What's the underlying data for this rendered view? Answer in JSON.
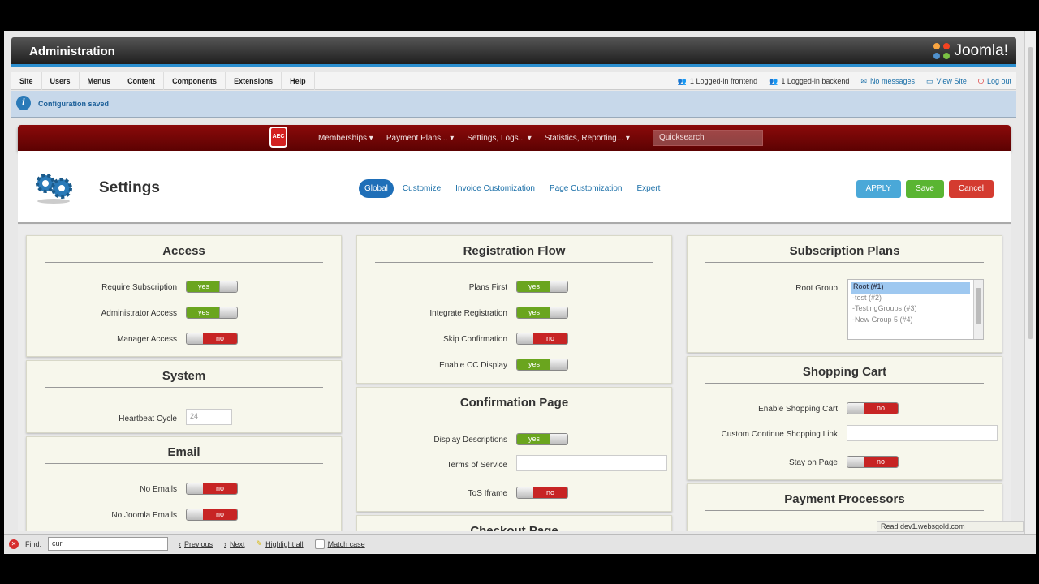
{
  "admin": {
    "title": "Administration",
    "logo": "Joomla!"
  },
  "menu": [
    "Site",
    "Users",
    "Menus",
    "Content",
    "Components",
    "Extensions",
    "Help"
  ],
  "status": {
    "frontend": "1 Logged-in frontend",
    "backend": "1 Logged-in backend",
    "messages": "No messages",
    "view_site": "View Site",
    "logout": "Log out"
  },
  "message": "Configuration saved",
  "aec": {
    "badge": "AEC",
    "nav": [
      "Memberships",
      "Payment Plans...",
      "Settings, Logs...",
      "Statistics, Reporting..."
    ],
    "quicksearch": "Quicksearch"
  },
  "settings": {
    "title": "Settings",
    "tabs": [
      "Global",
      "Customize",
      "Invoice Customization",
      "Page Customization",
      "Expert"
    ],
    "actions": {
      "apply": "APPLY",
      "save": "Save",
      "cancel": "Cancel"
    }
  },
  "toggle": {
    "yes": "yes",
    "no": "no"
  },
  "colors": {
    "header_blue": "#2b8fd0",
    "aec_red": "#8b0a0a",
    "tab_active": "#1f6fb8",
    "yes_green": "#6aa51e",
    "no_red": "#c72424"
  },
  "access": {
    "title": "Access",
    "require_subscription": {
      "label": "Require Subscription",
      "value": "yes"
    },
    "admin_access": {
      "label": "Administrator Access",
      "value": "yes"
    },
    "manager_access": {
      "label": "Manager Access",
      "value": "no"
    }
  },
  "system": {
    "title": "System",
    "heartbeat": {
      "label": "Heartbeat Cycle",
      "placeholder": "24"
    }
  },
  "email": {
    "title": "Email",
    "no_emails": {
      "label": "No Emails",
      "value": "no"
    },
    "no_joomla_emails": {
      "label": "No Joomla Emails",
      "value": "no"
    }
  },
  "registration": {
    "title": "Registration Flow",
    "plans_first": {
      "label": "Plans First",
      "value": "yes"
    },
    "integrate": {
      "label": "Integrate Registration",
      "value": "yes"
    },
    "skip_confirmation": {
      "label": "Skip Confirmation",
      "value": "no"
    },
    "cc_display": {
      "label": "Enable CC Display",
      "value": "yes"
    }
  },
  "confirmation": {
    "title": "Confirmation Page",
    "descriptions": {
      "label": "Display Descriptions",
      "value": "yes"
    },
    "tos": {
      "label": "Terms of Service"
    },
    "tos_iframe": {
      "label": "ToS Iframe",
      "value": "no"
    }
  },
  "checkout": {
    "title": "Checkout Page"
  },
  "plans": {
    "title": "Subscription Plans",
    "root_group": {
      "label": "Root Group",
      "options": [
        "Root (#1)",
        "-test (#2)",
        "-TestingGroups (#3)",
        "-New Group 5 (#4)"
      ],
      "selected": "Root (#1)"
    }
  },
  "cart": {
    "title": "Shopping Cart",
    "enable": {
      "label": "Enable Shopping Cart",
      "value": "no"
    },
    "continue_link": {
      "label": "Custom Continue Shopping Link"
    },
    "stay": {
      "label": "Stay on Page",
      "value": "no"
    }
  },
  "processors": {
    "title": "Payment Processors"
  },
  "tooltip": "Read dev1.websgold.com",
  "findbar": {
    "label": "Find:",
    "value": "curl",
    "previous": "Previous",
    "next": "Next",
    "highlight": "Highlight all",
    "match_case": "Match case"
  }
}
